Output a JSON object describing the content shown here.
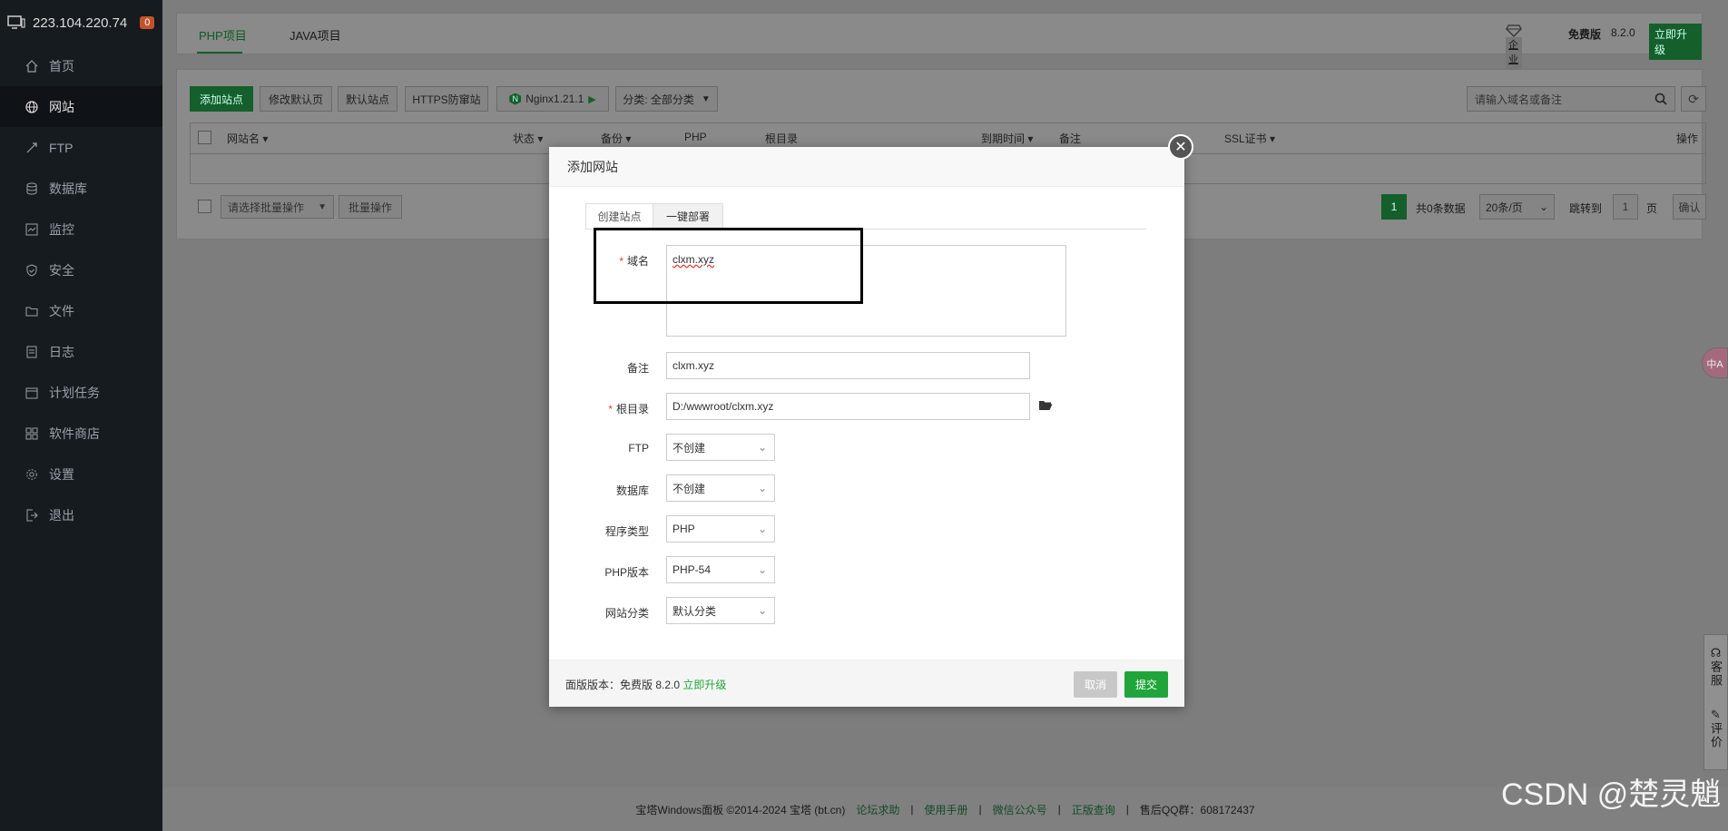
{
  "sidebar": {
    "server_ip": "223.104.220.74",
    "alert_count": "0",
    "items": [
      {
        "label": "首页",
        "icon": "home-icon"
      },
      {
        "label": "网站",
        "icon": "globe-icon",
        "active": true
      },
      {
        "label": "FTP",
        "icon": "ftp-icon"
      },
      {
        "label": "数据库",
        "icon": "database-icon"
      },
      {
        "label": "监控",
        "icon": "monitor-icon"
      },
      {
        "label": "安全",
        "icon": "shield-icon"
      },
      {
        "label": "文件",
        "icon": "folder-icon"
      },
      {
        "label": "日志",
        "icon": "log-icon"
      },
      {
        "label": "计划任务",
        "icon": "calendar-icon"
      },
      {
        "label": "软件商店",
        "icon": "grid-icon"
      },
      {
        "label": "设置",
        "icon": "gear-icon"
      },
      {
        "label": "退出",
        "icon": "logout-icon"
      }
    ]
  },
  "topbar": {
    "tabs": [
      "PHP项目",
      "JAVA项目"
    ],
    "edition_badge": "企业版",
    "free_label": "免费版",
    "version": "8.2.0",
    "upgrade": "立即升级"
  },
  "toolbar": {
    "add_site": "添加站点",
    "edit_default": "修改默认页",
    "default_site": "默认站点",
    "https_guard": "HTTPS防窜站",
    "nginx": "Nginx1.21.1",
    "category": "分类: 全部分类",
    "search_placeholder": "请输入域名或备注"
  },
  "table": {
    "headers": [
      "网站名",
      "状态",
      "备份",
      "PHP",
      "根目录",
      "到期时间",
      "备注",
      "SSL证书",
      "操作"
    ]
  },
  "pager": {
    "batch_placeholder": "请选择批量操作",
    "batch_btn": "批量操作",
    "current": "1",
    "total": "共0条数据",
    "per_page": "20条/页",
    "jump_to": "跳转到",
    "page_input": "1",
    "page_unit": "页",
    "confirm": "确认"
  },
  "modal": {
    "title": "添加网站",
    "tabs": [
      "创建站点",
      "一键部署"
    ],
    "domain_label": "域名",
    "domain_value": "clxm.xyz",
    "remark_label": "备注",
    "remark_value": "clxm.xyz",
    "root_label": "根目录",
    "root_value": "D:/wwwroot/clxm.xyz",
    "ftp_label": "FTP",
    "ftp_value": "不创建",
    "db_label": "数据库",
    "db_value": "不创建",
    "prog_label": "程序类型",
    "prog_value": "PHP",
    "php_label": "PHP版本",
    "php_value": "PHP-54",
    "cat_label": "网站分类",
    "cat_value": "默认分类",
    "footer_prefix": "面版版本：免费版 8.2.0",
    "footer_upgrade": "立即升级",
    "cancel": "取消",
    "submit": "提交"
  },
  "float": {
    "service": "客服",
    "review": "评价",
    "translate": "中A"
  },
  "footer": {
    "copyright": "宝塔Windows面板 ©2014-2024 宝塔 (bt.cn)",
    "links": [
      "论坛求助",
      "使用手册",
      "微信公众号",
      "正版查询"
    ],
    "qq": "售后QQ群：608172437"
  },
  "watermark": "CSDN @楚灵魈",
  "colors": {
    "brand_green": "#20a53a",
    "sidebar_bg": "#161b20"
  }
}
